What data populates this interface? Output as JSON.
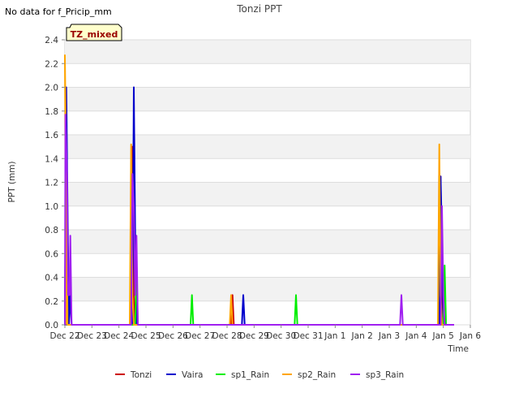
{
  "note": "No data for f_Pricip_mm",
  "chart_data": {
    "type": "line",
    "title": "Tonzi PPT",
    "xlabel": "Time",
    "ylabel": "PPT (mm)",
    "badge": "TZ_mixed",
    "xlim": [
      0,
      15
    ],
    "ylim": [
      0,
      2.4
    ],
    "grid": true,
    "legend_position": "bottom",
    "x_tick_labels": [
      "Dec 22",
      "Dec 23",
      "Dec 24",
      "Dec 25",
      "Dec 26",
      "Dec 27",
      "Dec 28",
      "Dec 29",
      "Dec 30",
      "Dec 31",
      "Jan 1",
      "Jan 2",
      "Jan 3",
      "Jan 4",
      "Jan 5",
      "Jan 6"
    ],
    "y_ticks": [
      0.0,
      0.2,
      0.4,
      0.6,
      0.8,
      1.0,
      1.2,
      1.4,
      1.6,
      1.8,
      2.0,
      2.2,
      2.4
    ],
    "y_tick_labels": [
      "0.0",
      "0.2",
      "0.4",
      "0.6",
      "0.8",
      "1.0",
      "1.2",
      "1.4",
      "1.6",
      "1.8",
      "2.0",
      "2.2",
      "2.4"
    ],
    "series": [
      {
        "name": "Tonzi",
        "color": "#cc0000",
        "points": [
          [
            0.0,
            0
          ],
          [
            0.05,
            1.75
          ],
          [
            0.1,
            0.75
          ],
          [
            0.15,
            0
          ],
          [
            2.45,
            0
          ],
          [
            2.5,
            1.5
          ],
          [
            2.55,
            0.25
          ],
          [
            2.6,
            0
          ],
          [
            6.15,
            0
          ],
          [
            6.2,
            0.25
          ],
          [
            6.25,
            0
          ],
          [
            13.85,
            0
          ],
          [
            13.9,
            1.25
          ],
          [
            13.95,
            0.25
          ],
          [
            14.0,
            0
          ]
        ]
      },
      {
        "name": "Vaira",
        "color": "#0000cc",
        "points": [
          [
            0.0,
            0
          ],
          [
            0.05,
            2.0
          ],
          [
            0.1,
            1.0
          ],
          [
            0.15,
            0
          ],
          [
            0.2,
            0.25
          ],
          [
            0.25,
            0
          ],
          [
            2.5,
            0
          ],
          [
            2.55,
            2.0
          ],
          [
            2.6,
            0.75
          ],
          [
            2.65,
            0
          ],
          [
            6.55,
            0
          ],
          [
            6.6,
            0.25
          ],
          [
            6.65,
            0
          ],
          [
            13.85,
            0
          ],
          [
            13.9,
            1.25
          ],
          [
            13.95,
            0.75
          ],
          [
            14.0,
            0
          ]
        ]
      },
      {
        "name": "sp1_Rain",
        "color": "#00ee00",
        "points": [
          [
            2.6,
            0
          ],
          [
            2.65,
            0.5
          ],
          [
            2.7,
            0
          ],
          [
            4.65,
            0
          ],
          [
            4.7,
            0.25
          ],
          [
            4.75,
            0
          ],
          [
            8.5,
            0
          ],
          [
            8.55,
            0.25
          ],
          [
            8.6,
            0
          ],
          [
            14.0,
            0
          ],
          [
            14.05,
            0.5
          ],
          [
            14.1,
            0
          ]
        ]
      },
      {
        "name": "sp2_Rain",
        "color": "#ffa500",
        "points": [
          [
            -0.05,
            0
          ],
          [
            0.0,
            2.27
          ],
          [
            0.05,
            1.25
          ],
          [
            0.1,
            0
          ],
          [
            2.4,
            0
          ],
          [
            2.45,
            1.52
          ],
          [
            2.5,
            0.25
          ],
          [
            2.55,
            0
          ],
          [
            6.1,
            0
          ],
          [
            6.15,
            0.25
          ],
          [
            6.2,
            0
          ],
          [
            13.8,
            0
          ],
          [
            13.85,
            1.52
          ],
          [
            13.9,
            0.25
          ],
          [
            13.95,
            0
          ]
        ]
      },
      {
        "name": "sp3_Rain",
        "color": "#a020f0",
        "points": [
          [
            0.0,
            0
          ],
          [
            0.02,
            1.77
          ],
          [
            0.08,
            1.25
          ],
          [
            0.12,
            0.25
          ],
          [
            0.17,
            0.25
          ],
          [
            0.2,
            0.75
          ],
          [
            0.25,
            0
          ],
          [
            2.45,
            0
          ],
          [
            2.5,
            1.27
          ],
          [
            2.55,
            1.0
          ],
          [
            2.6,
            0.25
          ],
          [
            2.65,
            0.75
          ],
          [
            2.7,
            0
          ],
          [
            12.4,
            0
          ],
          [
            12.45,
            0.25
          ],
          [
            12.5,
            0
          ],
          [
            13.9,
            0
          ],
          [
            13.95,
            1.0
          ],
          [
            14.0,
            0.25
          ],
          [
            14.05,
            0
          ],
          [
            14.4,
            0
          ]
        ]
      }
    ]
  }
}
